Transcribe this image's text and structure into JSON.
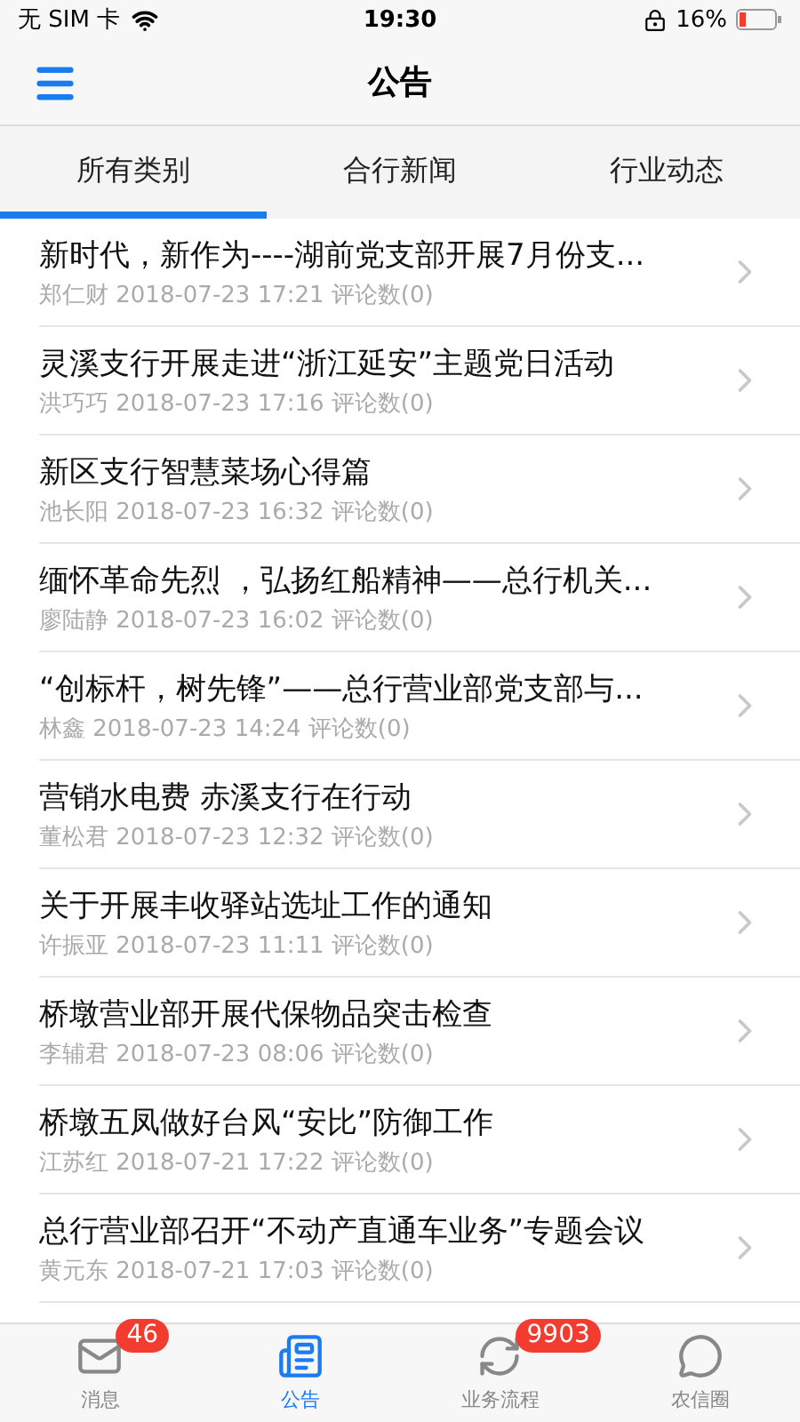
{
  "status_bar": {
    "carrier": "无 SIM 卡",
    "time": "19:30",
    "battery": "16%"
  },
  "nav": {
    "title": "公告"
  },
  "tabs": [
    {
      "label": "所有类别",
      "selected": true
    },
    {
      "label": "合行新闻",
      "selected": false
    },
    {
      "label": "行业动态",
      "selected": false
    }
  ],
  "articles": [
    {
      "title": "新时代，新作为----湖前党支部开展7月份支...",
      "meta": "郑仁财 2018-07-23 17:21 评论数(0)"
    },
    {
      "title": "灵溪支行开展走进“浙江延安”主题党日活动",
      "meta": "洪巧巧 2018-07-23 17:16 评论数(0)"
    },
    {
      "title": "新区支行智慧菜场心得篇",
      "meta": "池长阳 2018-07-23 16:32 评论数(0)"
    },
    {
      "title": "缅怀革命先烈 ，弘扬红船精神——总行机关...",
      "meta": "廖陆静 2018-07-23 16:02 评论数(0)"
    },
    {
      "title": "“创标杆，树先锋”——总行营业部党支部与...",
      "meta": "林鑫 2018-07-23 14:24 评论数(0)"
    },
    {
      "title": "营销水电费 赤溪支行在行动",
      "meta": "董松君 2018-07-23 12:32 评论数(0)"
    },
    {
      "title": "关于开展丰收驿站选址工作的通知",
      "meta": "许振亚 2018-07-23 11:11 评论数(0)"
    },
    {
      "title": "桥墩营业部开展代保物品突击检查",
      "meta": "李辅君 2018-07-23 08:06 评论数(0)"
    },
    {
      "title": "桥墩五凤做好台风“安比”防御工作",
      "meta": "江苏红 2018-07-21 17:22 评论数(0)"
    },
    {
      "title": "总行营业部召开“不动产直通车业务”专题会议",
      "meta": "黄元东 2018-07-21 17:03 评论数(0)"
    }
  ],
  "tab_bar": [
    {
      "kind": "mail",
      "label": "消息",
      "badge": "46",
      "selected": false
    },
    {
      "kind": "news",
      "label": "公告",
      "selected": true
    },
    {
      "kind": "flow",
      "label": "业务流程",
      "badge": "9903",
      "selected": false
    },
    {
      "kind": "chat",
      "label": "农信圈",
      "selected": false
    }
  ]
}
